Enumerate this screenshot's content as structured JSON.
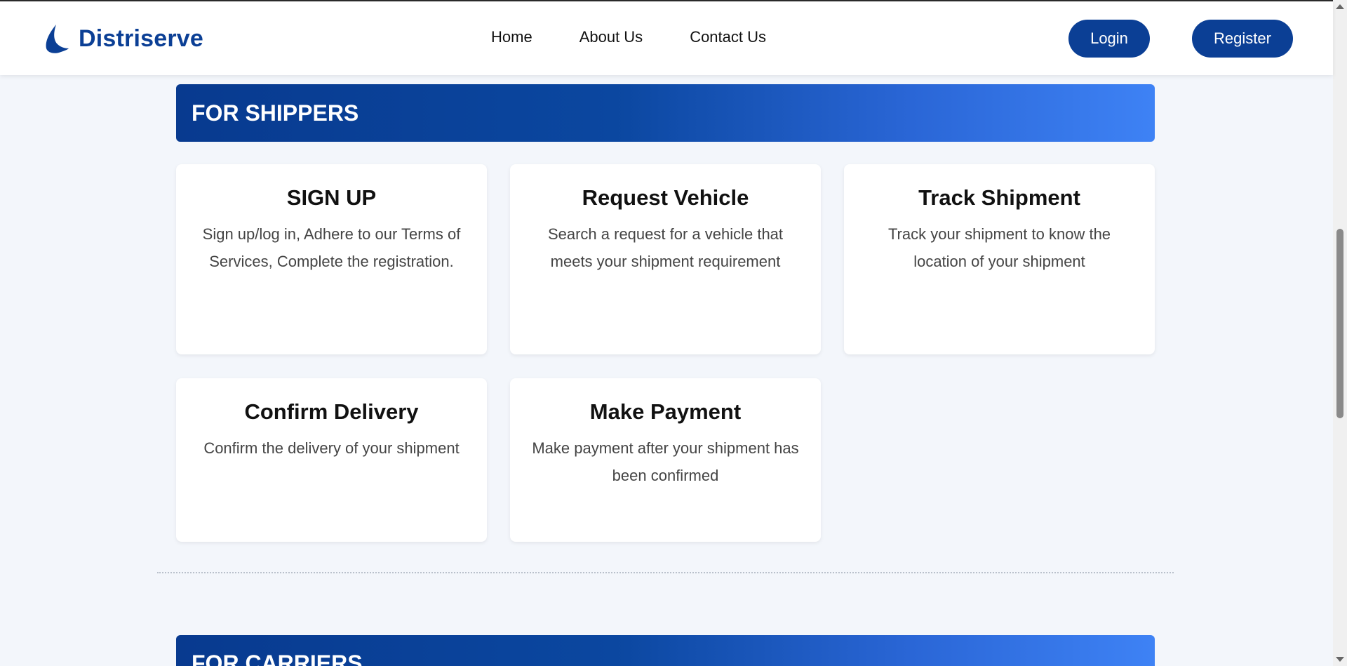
{
  "brand": {
    "name": "Distriserve",
    "color": "#0b3f95"
  },
  "nav": {
    "items": [
      {
        "label": "Home"
      },
      {
        "label": "About Us"
      },
      {
        "label": "Contact Us"
      }
    ],
    "login_label": "Login",
    "register_label": "Register"
  },
  "shippers": {
    "title": "FOR SHIPPERS",
    "cards": [
      {
        "title": "SIGN UP",
        "text": "Sign up/log in, Adhere to our Terms of Services, Complete the registration."
      },
      {
        "title": "Request Vehicle",
        "text": "Search a request for a vehicle that meets your shipment requirement"
      },
      {
        "title": "Track Shipment",
        "text": "Track your shipment to know the location of your shipment"
      },
      {
        "title": "Confirm Delivery",
        "text": "Confirm the delivery of your shipment"
      },
      {
        "title": "Make Payment",
        "text": "Make payment after your shipment has been confirmed"
      }
    ]
  },
  "carriers": {
    "title": "FOR CARRIERS"
  },
  "colors": {
    "banner_start": "#083a8f",
    "banner_end": "#3e82f5",
    "page_bg": "#f3f6fb"
  }
}
